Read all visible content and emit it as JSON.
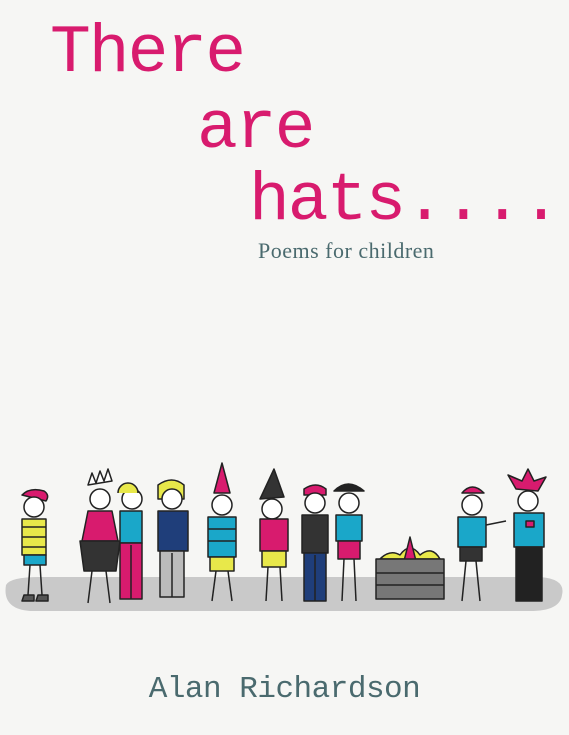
{
  "cover": {
    "title_lines": [
      "There",
      "are",
      "hats...."
    ],
    "subtitle": "Poems for children",
    "author": "Alan Richardson"
  },
  "colors": {
    "background": "#f6f6f4",
    "title": "#d81b6e",
    "subtitle": "#4a6a6e",
    "author": "#4a6a6e"
  },
  "illustration": {
    "icon": "children-in-hats-illustration",
    "palette": [
      "#e8e84a",
      "#d81b6e",
      "#1aa7c9",
      "#1f3e7a",
      "#555555"
    ]
  }
}
